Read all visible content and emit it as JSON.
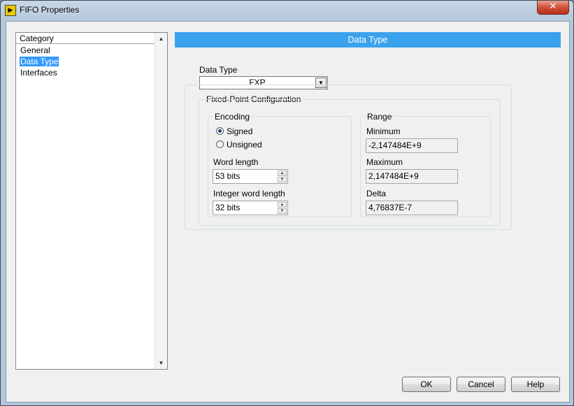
{
  "window": {
    "title": "FIFO Properties",
    "app_icon_glyph": "▶",
    "close_glyph": "✕"
  },
  "sidebar": {
    "header": "Category",
    "items": [
      {
        "label": "General",
        "selected": false
      },
      {
        "label": "Data Type",
        "selected": true
      },
      {
        "label": "Interfaces",
        "selected": false
      }
    ]
  },
  "page": {
    "banner_title": "Data Type",
    "data_type": {
      "label": "Data Type",
      "value": "FXP"
    },
    "fixed_point": {
      "title": "Fixed-Point Configuration",
      "encoding": {
        "title": "Encoding",
        "options": [
          {
            "label": "Signed",
            "checked": true
          },
          {
            "label": "Unsigned",
            "checked": false
          }
        ],
        "word_length_label": "Word length",
        "word_length_value": "53 bits",
        "integer_word_length_label": "Integer word length",
        "integer_word_length_value": "32 bits"
      },
      "range": {
        "title": "Range",
        "minimum_label": "Minimum",
        "minimum_value": "-2,147484E+9",
        "maximum_label": "Maximum",
        "maximum_value": "2,147484E+9",
        "delta_label": "Delta",
        "delta_value": "4,76837E-7"
      }
    }
  },
  "buttons": {
    "ok": "OK",
    "cancel": "Cancel",
    "help": "Help"
  },
  "colors": {
    "banner": "#3aa2ec",
    "selection": "#3399ff"
  },
  "icons": {
    "scroll_up": "▲",
    "scroll_down": "▼",
    "dropdown": "▼"
  }
}
